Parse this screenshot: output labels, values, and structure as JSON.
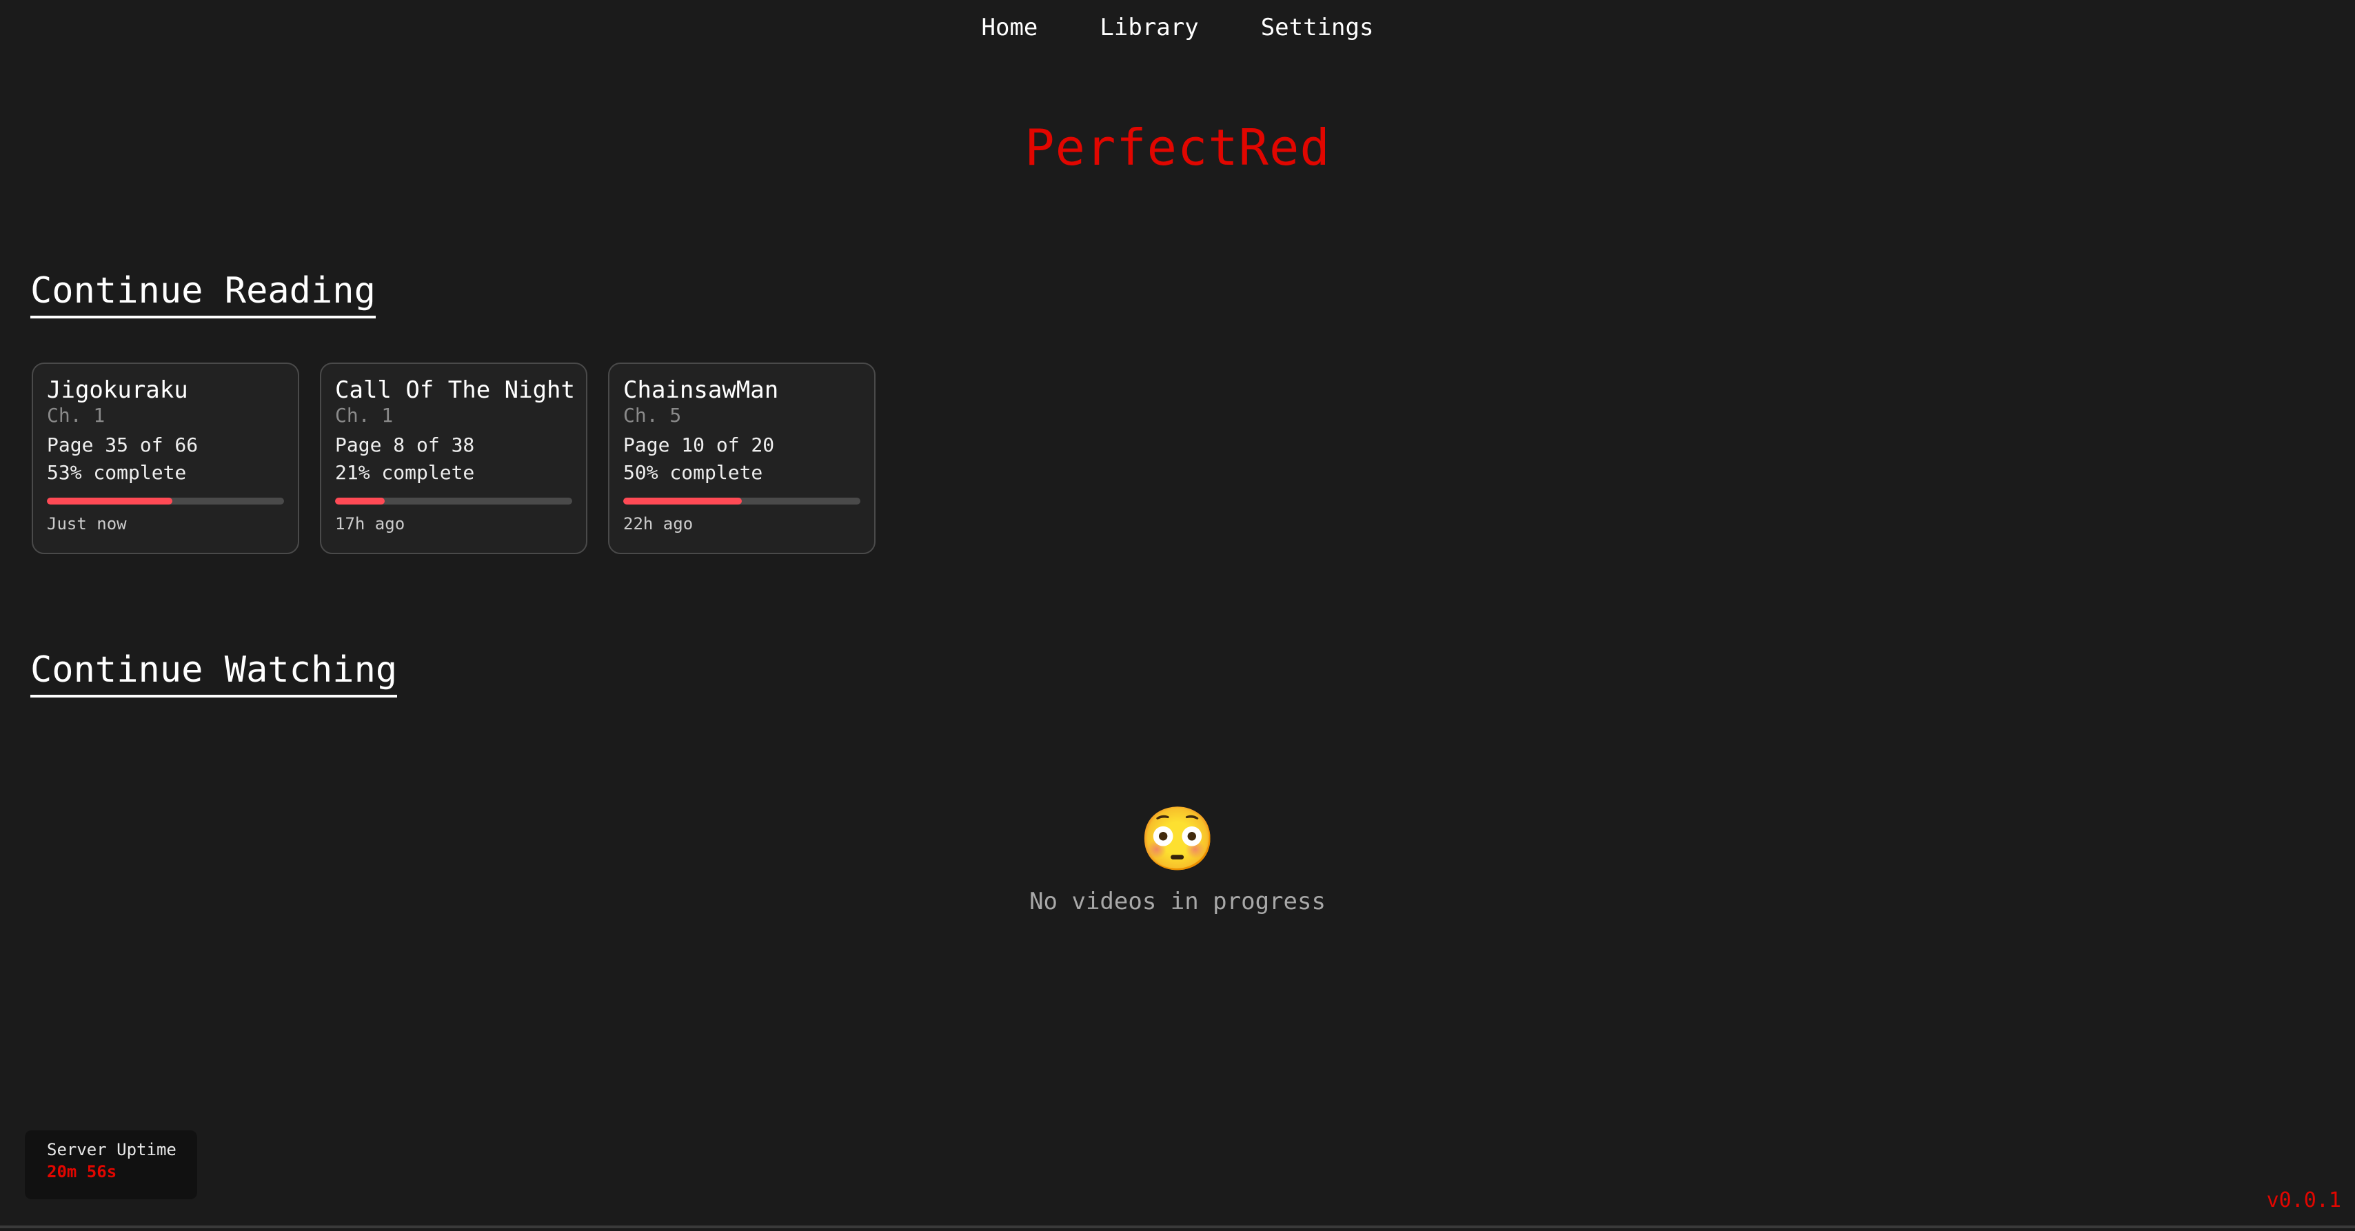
{
  "nav": {
    "home": "Home",
    "library": "Library",
    "settings": "Settings"
  },
  "brand": {
    "name": "PerfectRed",
    "color": "#e10600"
  },
  "continue_reading": {
    "title": "Continue Reading",
    "items": [
      {
        "title": "Jigokuraku",
        "chapter": "Ch. 1",
        "pages": "Page 35 of 66",
        "percent_text": "53% complete",
        "progress": 0.53,
        "time": "Just now"
      },
      {
        "title": "Call Of The Night",
        "chapter": "Ch. 1",
        "pages": "Page 8 of 38",
        "percent_text": "21% complete",
        "progress": 0.21,
        "time": "17h ago"
      },
      {
        "title": "ChainsawMan",
        "chapter": "Ch. 5",
        "pages": "Page 10 of 20",
        "percent_text": "50% complete",
        "progress": 0.5,
        "time": "22h ago"
      }
    ]
  },
  "continue_watching": {
    "title": "Continue Watching",
    "empty_icon": "flushed-face-icon",
    "empty_emoji": "😳",
    "empty_message": "No videos in progress"
  },
  "server_uptime": {
    "label": "Server Uptime",
    "value": "20m 56s"
  },
  "version": "v0.0.1",
  "colors": {
    "background": "#1b1b1b",
    "accent": "#e10600",
    "progress_fill": "#ff4a55",
    "progress_track": "#4a4a4a"
  }
}
